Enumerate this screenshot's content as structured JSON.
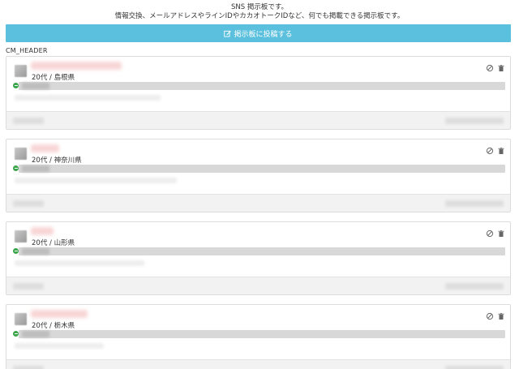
{
  "intro": {
    "line1": "SNS 掲示板です。",
    "line2": "情報交換、メールアドレスやラインIDやカカオトークIDなど、何でも掲載できる掲示板です。"
  },
  "post_button": {
    "label": "掲示板に投稿する",
    "icon": "edit-icon",
    "color": "#5bc0de"
  },
  "cm_header": "CM_HEADER",
  "posts": [
    {
      "age_location": "20代 / 島根県"
    },
    {
      "age_location": "20代 / 神奈川県"
    },
    {
      "age_location": "20代 / 山形県"
    },
    {
      "age_location": "20代 / 栃木県"
    }
  ],
  "colors": {
    "accent": "#5bc0de",
    "line_green": "#3aa54a",
    "card_border": "#dcdcdc",
    "footer_bg": "#f2f2f2"
  }
}
